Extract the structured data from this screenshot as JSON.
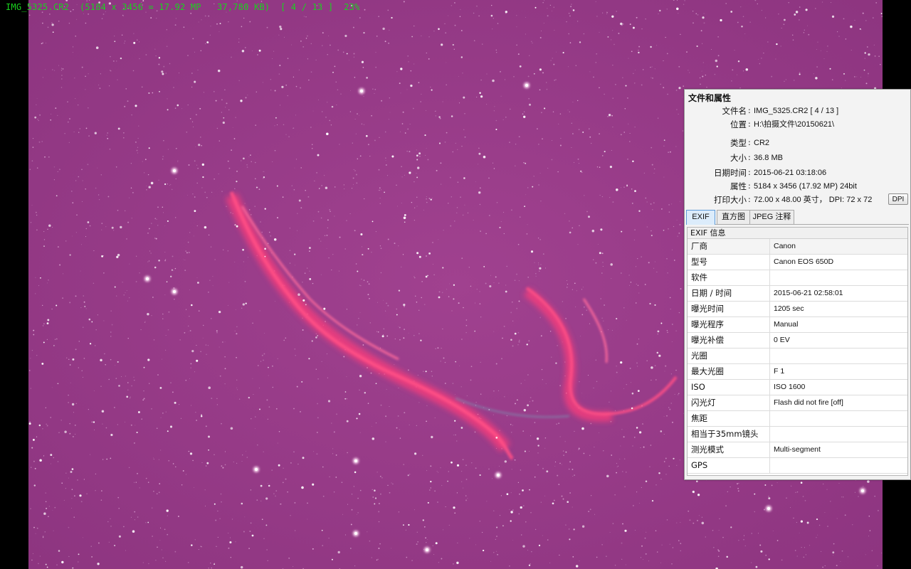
{
  "status": {
    "text": "IMG_5325.CR2  (5184 x 3456 = 17.92 MP   37,780 KB)  [ 4 / 13 ]  23%"
  },
  "panel": {
    "title": "文件和属性",
    "properties": [
      {
        "label": "文件名",
        "value": "IMG_5325.CR2   [ 4 / 13 ]"
      },
      {
        "label": "位置",
        "value": "H:\\拍摄文件\\20150621\\"
      },
      {
        "label": "类型",
        "value": "CR2"
      },
      {
        "label": "大小",
        "value": "36.8 MB"
      },
      {
        "label": "日期时间",
        "value": "2015-06-21 03:18:06"
      },
      {
        "label": "属性",
        "value": "5184 x 3456 (17.92 MP)  24bit"
      },
      {
        "label": "打印大小",
        "value": "72.00 x 48.00 英寸，  DPI: 72 x 72"
      }
    ],
    "dpi_button": "DPI",
    "tabs": [
      {
        "label": "EXIF",
        "active": true
      },
      {
        "label": "直方图",
        "active": false
      },
      {
        "label": "JPEG 注释",
        "active": false
      }
    ],
    "exif_title": "EXIF 信息",
    "exif_rows": [
      {
        "key": "厂商",
        "value": "Canon"
      },
      {
        "key": "型号",
        "value": "Canon EOS 650D"
      },
      {
        "key": "软件",
        "value": ""
      },
      {
        "key": "日期 / 时间",
        "value": "2015-06-21 02:58:01"
      },
      {
        "key": "曝光时间",
        "value": "1205 sec"
      },
      {
        "key": "曝光程序",
        "value": "Manual"
      },
      {
        "key": "曝光补偿",
        "value": "0 EV"
      },
      {
        "key": "光圈",
        "value": ""
      },
      {
        "key": "最大光圈",
        "value": "F 1"
      },
      {
        "key": "ISO",
        "value": "ISO 1600"
      },
      {
        "key": "闪光灯",
        "value": "Flash did not fire [off]"
      },
      {
        "key": "焦距",
        "value": ""
      },
      {
        "key": "相当于35mm镜头",
        "value": ""
      },
      {
        "key": "测光模式",
        "value": "Multi-segment"
      },
      {
        "key": "GPS",
        "value": ""
      }
    ]
  },
  "colors": {
    "status_text": "#19d21e",
    "sky": "#9b3d8e",
    "nebula": "#ff3c78"
  }
}
